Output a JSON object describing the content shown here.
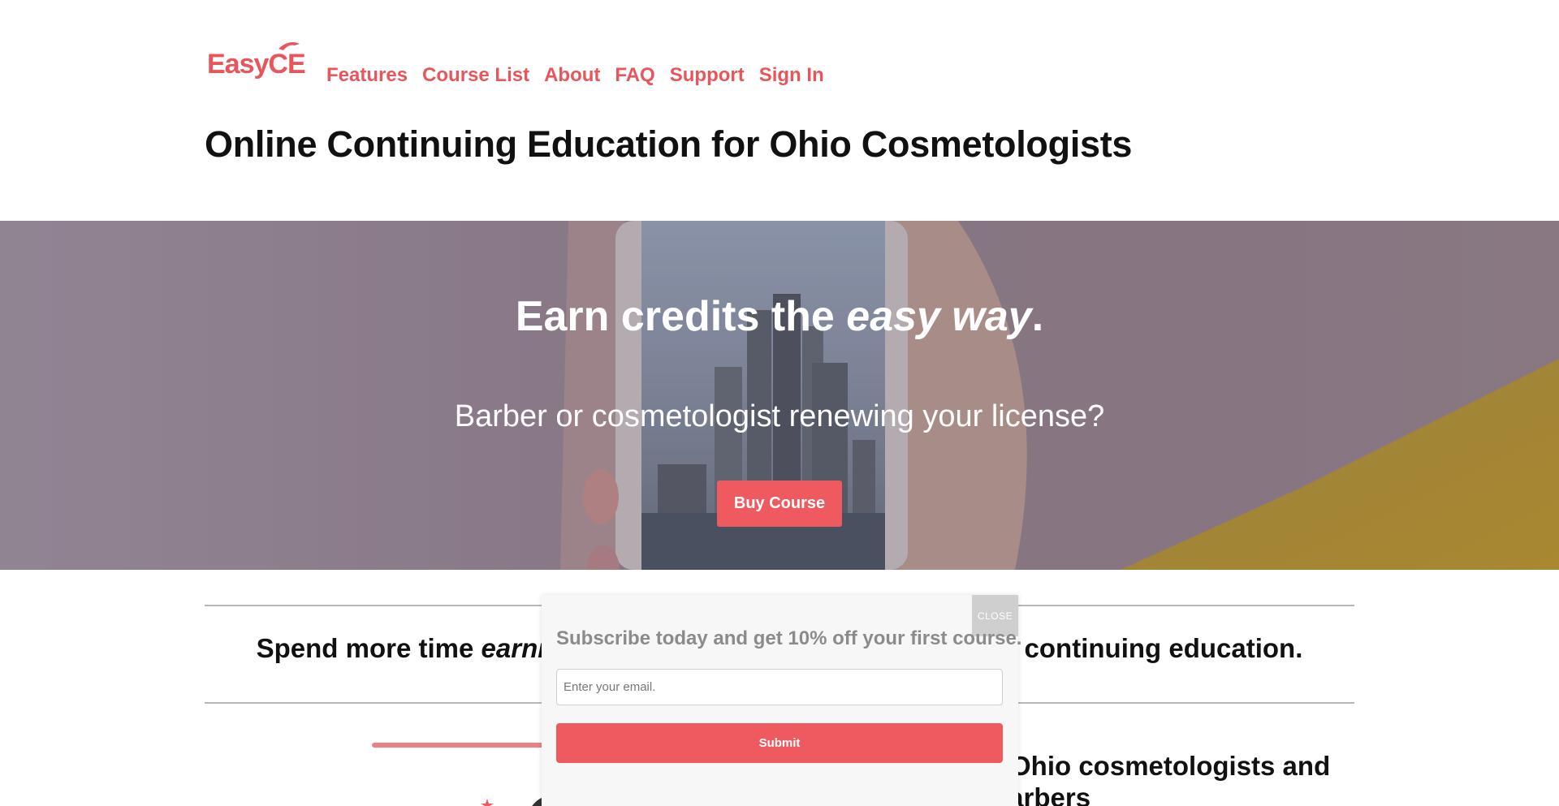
{
  "brand": {
    "logo_text": "EasyCE",
    "logo_color": "#e8555b"
  },
  "nav": {
    "items": [
      {
        "label": "Features"
      },
      {
        "label": "Course List"
      },
      {
        "label": "About"
      },
      {
        "label": "FAQ"
      },
      {
        "label": "Support"
      },
      {
        "label": "Sign In"
      }
    ]
  },
  "page_title": "Online Continuing Education for Ohio Cosmetologists",
  "hero": {
    "headline_prefix": "Earn credits the ",
    "headline_emphasis": "easy way",
    "headline_suffix": ".",
    "subheadline": "Barber or cosmetologist renewing your license?",
    "cta_label": "Buy Course",
    "cta_color": "#ef5a60"
  },
  "tagline": {
    "prefix": "Spend more time ",
    "emphasis": "earni",
    "suffix": "t continuing education."
  },
  "section": {
    "heading": "r Ohio cosmetologists and barbers"
  },
  "popup": {
    "close_label": "CLOSE",
    "title": "Subscribe today and get 10% off your first course.",
    "email_placeholder": "Enter your email.",
    "submit_label": "Submit"
  }
}
